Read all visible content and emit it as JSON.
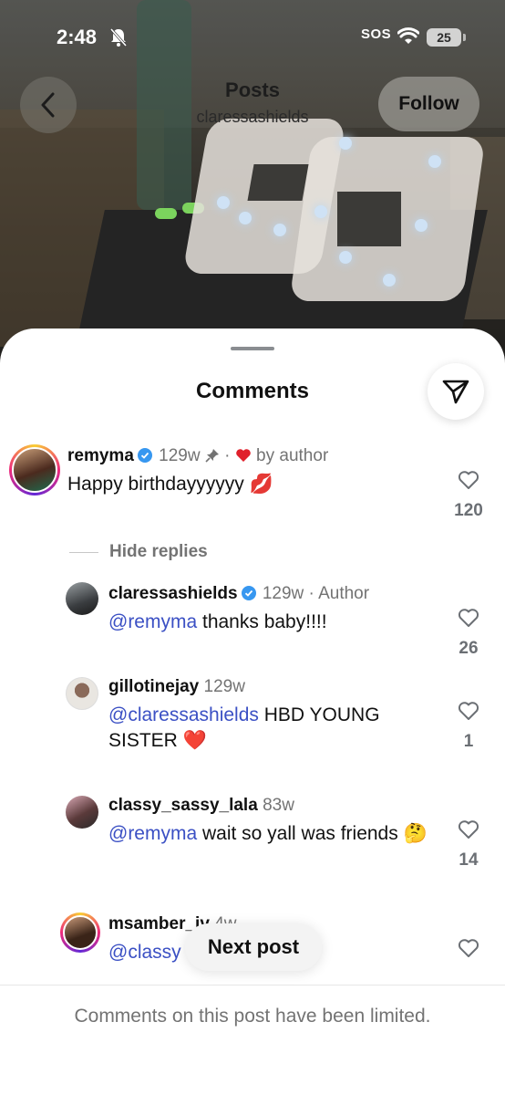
{
  "status_bar": {
    "time": "2:48",
    "sos": "SOS",
    "battery": "25"
  },
  "header": {
    "title": "Posts",
    "subtitle": "claressashields",
    "follow_label": "Follow"
  },
  "sheet": {
    "title": "Comments"
  },
  "comments": [
    {
      "username": "remyma",
      "time": "129w",
      "liked_by": "by author",
      "text": "Happy birthdayyyyyy 💋",
      "likes": "120"
    }
  ],
  "hide_replies_label": "Hide replies",
  "replies": [
    {
      "username": "claressashields",
      "time": "129w",
      "badge": "Author",
      "mention": "@remyma",
      "text": " thanks baby!!!!",
      "likes": "26"
    },
    {
      "username": "gillotinejay",
      "time": "129w",
      "mention": "@claressashields",
      "text": " HBD YOUNG SISTER ❤️",
      "likes": "1"
    },
    {
      "username": "classy_sassy_lala",
      "time": "83w",
      "mention": "@remyma",
      "text": " wait so yall was friends 🤔",
      "likes": "14"
    },
    {
      "username": "msamber_iv",
      "time": "4w",
      "mention": "@classy",
      "text": ""
    }
  ],
  "next_post_label": "Next post",
  "footer": {
    "limited_text": "Comments on this post have been limited."
  },
  "colors": {
    "mention": "#3b50c4",
    "verified": "#3797f0",
    "heart_red": "#e0202b"
  },
  "icons": [
    "chevron-left-icon",
    "send-icon",
    "heart-outline-icon",
    "verified-badge-icon",
    "pin-icon",
    "bell-slash-icon",
    "wifi-icon"
  ]
}
